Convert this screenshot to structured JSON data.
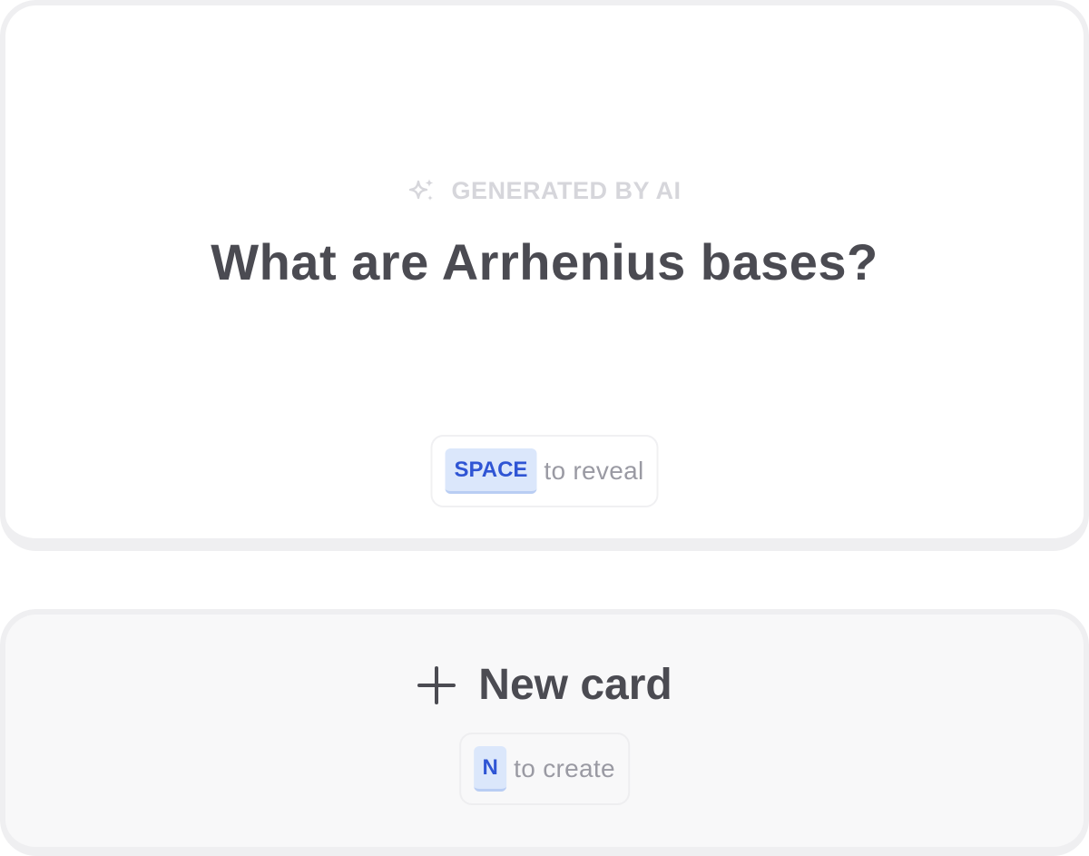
{
  "card": {
    "ai_label": "GENERATED BY AI",
    "question": "What are Arrhenius bases?",
    "reveal_key": "SPACE",
    "reveal_text": "to reveal"
  },
  "new_card": {
    "label": "New card",
    "create_key": "N",
    "create_text": "to create"
  },
  "icons": {
    "ai": "sparkle-icon",
    "add": "plus-icon"
  },
  "colors": {
    "key_background": "#dbe7fb",
    "key_text": "#2f55d4",
    "title_text": "#4b4b52",
    "muted_text": "#9a9aa3"
  }
}
